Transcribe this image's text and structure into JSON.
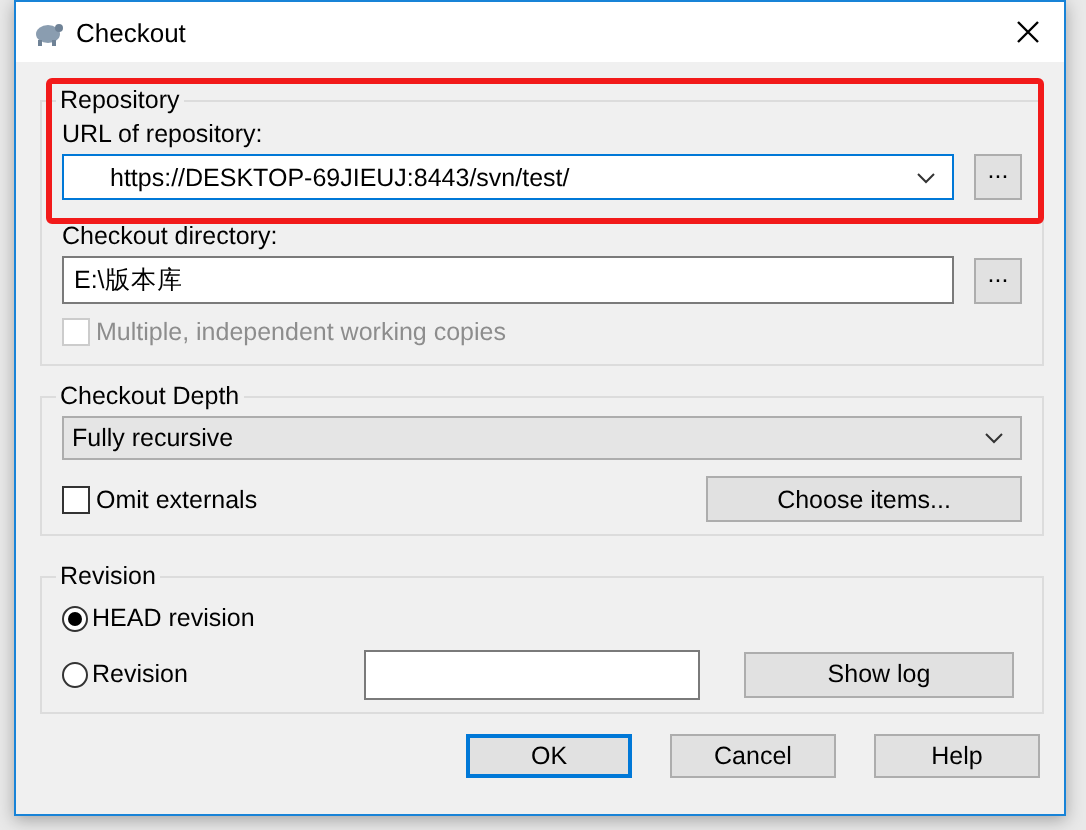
{
  "window": {
    "title": "Checkout"
  },
  "repository": {
    "title": "Repository",
    "highlighted": true,
    "url_label": "URL of repository:",
    "url": "https://DESKTOP-69JIEUJ:8443/svn/test/",
    "url_browse": "...",
    "directory_label": "Checkout directory:",
    "directory": "E:\\版本库",
    "directory_browse": "...",
    "multiple": {
      "label": "Multiple, independent working copies",
      "checked": false,
      "disabled": true
    }
  },
  "depth": {
    "title": "Checkout Depth",
    "value": "Fully recursive",
    "omit_externals": {
      "label": "Omit externals",
      "checked": false
    },
    "choose_button": "Choose items..."
  },
  "revision": {
    "title": "Revision",
    "options": [
      {
        "label": "HEAD revision",
        "selected": true
      },
      {
        "label": "Revision",
        "selected": false
      }
    ],
    "show_log": "Show log"
  },
  "buttons": [
    {
      "label": "OK",
      "default": true
    },
    {
      "label": "Cancel",
      "default": false
    },
    {
      "label": "Help",
      "default": false
    }
  ]
}
